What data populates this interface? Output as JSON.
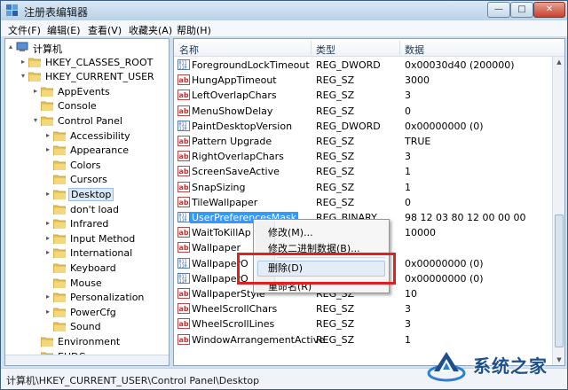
{
  "window": {
    "title": "注册表编辑器",
    "buttons": {
      "minimize": "—",
      "maximize": "□",
      "close": "✕"
    }
  },
  "menu": [
    "文件(F)",
    "编辑(E)",
    "查看(V)",
    "收藏夹(A)",
    "帮助(H)"
  ],
  "tree": {
    "items": [
      {
        "label": "计算机",
        "level": 0,
        "expander": "▴",
        "icon": "computer-icon"
      },
      {
        "label": "HKEY_CLASSES_ROOT",
        "level": 1,
        "expander": "▸",
        "icon": "folder-icon"
      },
      {
        "label": "HKEY_CURRENT_USER",
        "level": 1,
        "expander": "▾",
        "icon": "folder-icon"
      },
      {
        "label": "AppEvents",
        "level": 2,
        "expander": "▸",
        "icon": "folder-icon"
      },
      {
        "label": "Console",
        "level": 2,
        "expander": "",
        "icon": "folder-icon"
      },
      {
        "label": "Control Panel",
        "level": 2,
        "expander": "▾",
        "icon": "folder-icon"
      },
      {
        "label": "Accessibility",
        "level": 3,
        "expander": "▸",
        "icon": "folder-icon"
      },
      {
        "label": "Appearance",
        "level": 3,
        "expander": "▸",
        "icon": "folder-icon"
      },
      {
        "label": "Colors",
        "level": 3,
        "expander": "",
        "icon": "folder-icon"
      },
      {
        "label": "Cursors",
        "level": 3,
        "expander": "",
        "icon": "folder-icon"
      },
      {
        "label": "Desktop",
        "level": 3,
        "expander": "▸",
        "icon": "folder-icon",
        "selected": true
      },
      {
        "label": "don't load",
        "level": 3,
        "expander": "",
        "icon": "folder-icon"
      },
      {
        "label": "Infrared",
        "level": 3,
        "expander": "▸",
        "icon": "folder-icon"
      },
      {
        "label": "Input Method",
        "level": 3,
        "expander": "▸",
        "icon": "folder-icon"
      },
      {
        "label": "International",
        "level": 3,
        "expander": "▸",
        "icon": "folder-icon"
      },
      {
        "label": "Keyboard",
        "level": 3,
        "expander": "",
        "icon": "folder-icon"
      },
      {
        "label": "Mouse",
        "level": 3,
        "expander": "",
        "icon": "folder-icon"
      },
      {
        "label": "Personalization",
        "level": 3,
        "expander": "▸",
        "icon": "folder-icon"
      },
      {
        "label": "PowerCfg",
        "level": 3,
        "expander": "▸",
        "icon": "folder-icon"
      },
      {
        "label": "Sound",
        "level": 3,
        "expander": "",
        "icon": "folder-icon"
      },
      {
        "label": "Environment",
        "level": 2,
        "expander": "",
        "icon": "folder-icon"
      },
      {
        "label": "EUDC",
        "level": 2,
        "expander": "▸",
        "icon": "folder-icon"
      }
    ]
  },
  "list": {
    "columns": [
      "名称",
      "类型",
      "数据"
    ],
    "rows": [
      {
        "name": "ForegroundLockTimeout",
        "type": "REG_DWORD",
        "data": "0x00030d40 (200000)",
        "icon": "binary-value-icon"
      },
      {
        "name": "HungAppTimeout",
        "type": "REG_SZ",
        "data": "3000",
        "icon": "string-value-icon"
      },
      {
        "name": "LeftOverlapChars",
        "type": "REG_SZ",
        "data": "3",
        "icon": "string-value-icon"
      },
      {
        "name": "MenuShowDelay",
        "type": "REG_SZ",
        "data": "0",
        "icon": "string-value-icon"
      },
      {
        "name": "PaintDesktopVersion",
        "type": "REG_DWORD",
        "data": "0x00000000 (0)",
        "icon": "binary-value-icon"
      },
      {
        "name": "Pattern Upgrade",
        "type": "REG_SZ",
        "data": "TRUE",
        "icon": "string-value-icon"
      },
      {
        "name": "RightOverlapChars",
        "type": "REG_SZ",
        "data": "3",
        "icon": "string-value-icon"
      },
      {
        "name": "ScreenSaveActive",
        "type": "REG_SZ",
        "data": "1",
        "icon": "string-value-icon"
      },
      {
        "name": "SnapSizing",
        "type": "REG_SZ",
        "data": "1",
        "icon": "string-value-icon"
      },
      {
        "name": "TileWallpaper",
        "type": "REG_SZ",
        "data": "0",
        "icon": "string-value-icon"
      },
      {
        "name": "UserPreferencesMask",
        "type": "REG_BINARY",
        "data": "98 12 03 80 12 00 00 00",
        "icon": "binary-value-icon",
        "selected": true
      },
      {
        "name": "WaitToKillAp",
        "type": "",
        "data": "10000",
        "icon": "string-value-icon"
      },
      {
        "name": "Wallpaper",
        "type": "",
        "data": "",
        "icon": "string-value-icon"
      },
      {
        "name": "WallpaperO",
        "type": "",
        "data": "0x00000000 (0)",
        "icon": "binary-value-icon"
      },
      {
        "name": "WallpaperO",
        "type": "",
        "data": "0x00000000 (0)",
        "icon": "binary-value-icon"
      },
      {
        "name": "WallpaperStyle",
        "type": "REG_SZ",
        "data": "10",
        "icon": "string-value-icon"
      },
      {
        "name": "WheelScrollChars",
        "type": "REG_SZ",
        "data": "3",
        "icon": "string-value-icon"
      },
      {
        "name": "WheelScrollLines",
        "type": "REG_SZ",
        "data": "3",
        "icon": "string-value-icon"
      },
      {
        "name": "WindowArrangementActive",
        "type": "REG_SZ",
        "data": "1",
        "icon": "string-value-icon"
      }
    ]
  },
  "context_menu": {
    "items": [
      "修改(M)...",
      "修改二进制数据(B)...",
      "删除(D)",
      "重命名(R)"
    ],
    "highlighted": "删除(D)"
  },
  "status": {
    "path": "计算机\\HKEY_CURRENT_USER\\Control Panel\\Desktop"
  },
  "watermark": {
    "text": "系统之家"
  },
  "colors": {
    "selection": "#3399ff",
    "highlight_box": "#e02020",
    "window_frame": "#cfe0ee"
  }
}
